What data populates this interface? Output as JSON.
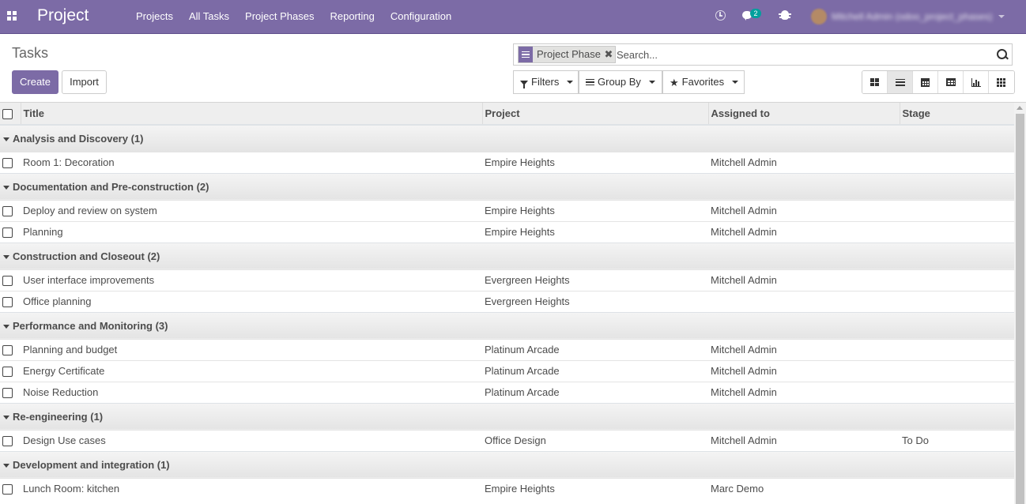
{
  "navbar": {
    "brand": "Project",
    "menu": [
      "Projects",
      "All Tasks",
      "Project Phases",
      "Reporting",
      "Configuration"
    ],
    "messages_count": "2",
    "user_name": "Mitchell Admin (odoo_project_phases)"
  },
  "control": {
    "title": "Tasks",
    "create_label": "Create",
    "import_label": "Import",
    "facet_label": "Project Phase",
    "facet_remove": "✖",
    "search_placeholder": "Search...",
    "filters_label": "Filters",
    "groupby_label": "Group By",
    "favorites_label": "Favorites",
    "views": [
      "kanban",
      "list",
      "calendar",
      "pivot",
      "graph",
      "activity"
    ],
    "active_view": "list"
  },
  "table": {
    "columns": [
      "Title",
      "Project",
      "Assigned to",
      "Stage"
    ],
    "groups": [
      {
        "label": "Analysis and Discovery (1)",
        "rows": [
          {
            "title": "Room 1: Decoration",
            "project": "Empire Heights",
            "assigned": "Mitchell Admin",
            "stage": ""
          }
        ]
      },
      {
        "label": "Documentation and Pre-construction (2)",
        "rows": [
          {
            "title": "Deploy and review on system",
            "project": "Empire Heights",
            "assigned": "Mitchell Admin",
            "stage": ""
          },
          {
            "title": "Planning",
            "project": "Empire Heights",
            "assigned": "Mitchell Admin",
            "stage": ""
          }
        ]
      },
      {
        "label": "Construction and Closeout (2)",
        "rows": [
          {
            "title": "User interface improvements",
            "project": "Evergreen Heights",
            "assigned": "Mitchell Admin",
            "stage": ""
          },
          {
            "title": "Office planning",
            "project": "Evergreen Heights",
            "assigned": "",
            "stage": ""
          }
        ]
      },
      {
        "label": "Performance and Monitoring (3)",
        "rows": [
          {
            "title": "Planning and budget",
            "project": "Platinum Arcade",
            "assigned": "Mitchell Admin",
            "stage": ""
          },
          {
            "title": "Energy Certificate",
            "project": "Platinum Arcade",
            "assigned": "Mitchell Admin",
            "stage": ""
          },
          {
            "title": "Noise Reduction",
            "project": "Platinum Arcade",
            "assigned": "Mitchell Admin",
            "stage": ""
          }
        ]
      },
      {
        "label": "Re-engineering (1)",
        "rows": [
          {
            "title": "Design Use cases",
            "project": "Office Design",
            "assigned": "Mitchell Admin",
            "stage": "To Do"
          }
        ]
      },
      {
        "label": "Development and integration (1)",
        "rows": [
          {
            "title": "Lunch Room: kitchen",
            "project": "Empire Heights",
            "assigned": "Marc Demo",
            "stage": ""
          }
        ]
      }
    ]
  },
  "colors": {
    "brand": "#7c6ba6",
    "badge": "#00a09d"
  }
}
